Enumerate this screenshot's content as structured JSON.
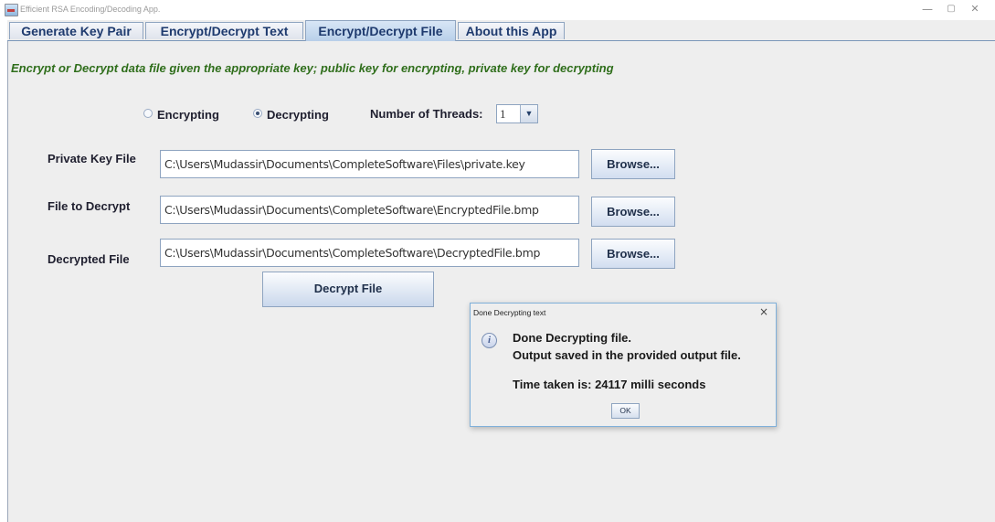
{
  "window": {
    "title": "Efficient RSA Encoding/Decoding App.",
    "minimize": "—",
    "maximize": "▢",
    "close": "✕"
  },
  "tabs": [
    {
      "label": "Generate Key Pair",
      "active": false
    },
    {
      "label": "Encrypt/Decrypt Text",
      "active": false
    },
    {
      "label": "Encrypt/Decrypt File",
      "active": true
    },
    {
      "label": "About this App",
      "active": false
    }
  ],
  "main": {
    "description": "Encrypt or Decrypt data file given the appropriate key; public key for encrypting, private key for decrypting",
    "mode": {
      "encrypting_label": "Encrypting",
      "decrypting_label": "Decrypting",
      "selected": "Decrypting"
    },
    "threads": {
      "label": "Number of Threads:",
      "value": "1"
    },
    "fields": [
      {
        "label": "Private Key File",
        "value": "C:\\Users\\Mudassir\\Documents\\CompleteSoftware\\Files\\private.key",
        "button": "Browse..."
      },
      {
        "label": "File to Decrypt",
        "value": "C:\\Users\\Mudassir\\Documents\\CompleteSoftware\\EncryptedFile.bmp",
        "button": "Browse..."
      },
      {
        "label": "Decrypted File",
        "value": "C:\\Users\\Mudassir\\Documents\\CompleteSoftware\\DecryptedFile.bmp",
        "button": "Browse..."
      }
    ],
    "action_button": "Decrypt File"
  },
  "dialog": {
    "title": "Done Decrypting text",
    "close": "×",
    "line1": "Done Decrypting file.",
    "line2": "Output saved in the provided output file.",
    "line3": "Time taken is: 24117 milli seconds",
    "ok_label": "OK"
  }
}
